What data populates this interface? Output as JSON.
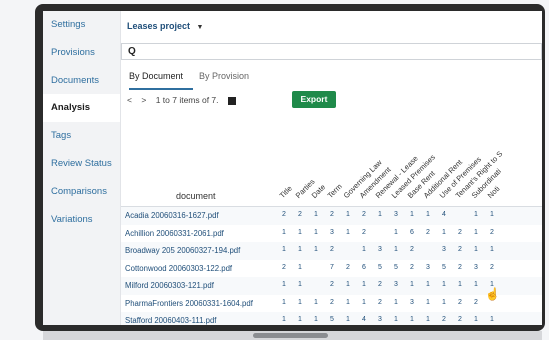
{
  "sidebar": {
    "items": [
      {
        "label": "Settings",
        "active": false
      },
      {
        "label": "Provisions",
        "active": false
      },
      {
        "label": "Documents",
        "active": false
      },
      {
        "label": "Analysis",
        "active": true
      },
      {
        "label": "Tags",
        "active": false
      },
      {
        "label": "Review Status",
        "active": false
      },
      {
        "label": "Comparisons",
        "active": false
      },
      {
        "label": "Variations",
        "active": false
      }
    ]
  },
  "header": {
    "project_label": "Leases project",
    "project_caret": "▼",
    "search_icon": "Q"
  },
  "tabs": [
    {
      "label": "By Document",
      "active": true
    },
    {
      "label": "By Provision",
      "active": false
    }
  ],
  "pager": {
    "prev": "<",
    "next": ">",
    "range_text": "1 to 7 items of 7.",
    "export_label": "Export"
  },
  "table": {
    "document_header": "document",
    "columns": [
      "Title",
      "Parties",
      "Date",
      "Term",
      "Governing Law",
      "Amendment",
      "Renewal - Lease",
      "Leased Premises",
      "Base Rent",
      "Additional Rent",
      "Use of Premises",
      "Tenant's Right to S",
      "Subordinati",
      "Noti"
    ],
    "rows": [
      {
        "document": "Acadia 20060316-1627.pdf",
        "values": [
          "2",
          "2",
          "1",
          "2",
          "1",
          "2",
          "1",
          "3",
          "1",
          "1",
          "4",
          "",
          "1",
          "1"
        ]
      },
      {
        "document": "Achillion 20060331-2061.pdf",
        "values": [
          "1",
          "1",
          "1",
          "3",
          "1",
          "2",
          "",
          "1",
          "6",
          "2",
          "1",
          "2",
          "1",
          "2"
        ]
      },
      {
        "document": "Broadway 205 20060327-194.pdf",
        "values": [
          "1",
          "1",
          "1",
          "2",
          "",
          "1",
          "3",
          "1",
          "2",
          "",
          "3",
          "2",
          "1",
          "1"
        ]
      },
      {
        "document": "Cottonwood 20060303-122.pdf",
        "values": [
          "2",
          "1",
          "",
          "7",
          "2",
          "6",
          "5",
          "5",
          "2",
          "3",
          "5",
          "2",
          "3",
          "2"
        ]
      },
      {
        "document": "Milford 20060303-121.pdf",
        "values": [
          "1",
          "1",
          "",
          "2",
          "1",
          "1",
          "2",
          "3",
          "1",
          "1",
          "1",
          "1",
          "1",
          "1"
        ]
      },
      {
        "document": "PharmaFrontiers 20060331-1604.pdf",
        "values": [
          "1",
          "1",
          "1",
          "2",
          "1",
          "1",
          "2",
          "1",
          "3",
          "1",
          "1",
          "2",
          "2",
          ""
        ]
      },
      {
        "document": "Stafford 20060403-111.pdf",
        "values": [
          "1",
          "1",
          "1",
          "5",
          "1",
          "4",
          "3",
          "1",
          "1",
          "1",
          "2",
          "2",
          "1",
          "1"
        ]
      }
    ]
  },
  "icons": {
    "cursor": "hand-pointer-icon",
    "search": "search-icon",
    "export_box": "export-icon"
  }
}
